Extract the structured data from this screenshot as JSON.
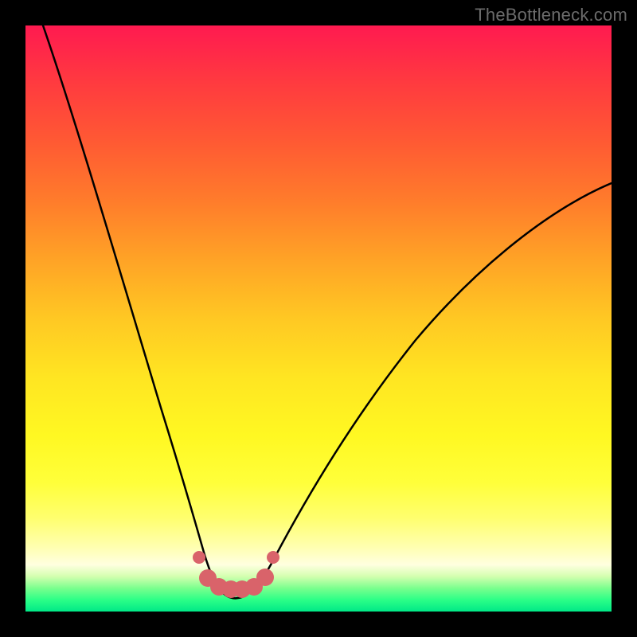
{
  "watermark": "TheBottleneck.com",
  "chart_data": {
    "type": "line",
    "title": "",
    "xlabel": "",
    "ylabel": "",
    "xlim": [
      0,
      100
    ],
    "ylim": [
      0,
      100
    ],
    "series": [
      {
        "name": "bottleneck-curve",
        "x": [
          3,
          5,
          8,
          12,
          16,
          20,
          24,
          27,
          29,
          31,
          33,
          35,
          39,
          42,
          46,
          52,
          60,
          70,
          82,
          95,
          100
        ],
        "y": [
          100,
          91,
          82,
          70,
          58,
          46,
          34,
          24,
          16,
          10,
          6,
          5,
          5,
          8,
          16,
          27,
          40,
          52,
          62,
          70,
          73
        ]
      },
      {
        "name": "highlight-markers",
        "x": [
          29.5,
          31,
          33,
          35,
          37,
          39,
          41,
          42.2
        ],
        "y": [
          9.3,
          5.7,
          4.3,
          4.0,
          4.0,
          4.3,
          5.8,
          9.3
        ]
      }
    ],
    "colors": {
      "curve": "#000000",
      "marker": "#d9636a",
      "gradient_top": "#ff1a50",
      "gradient_bottom": "#00e887"
    }
  }
}
